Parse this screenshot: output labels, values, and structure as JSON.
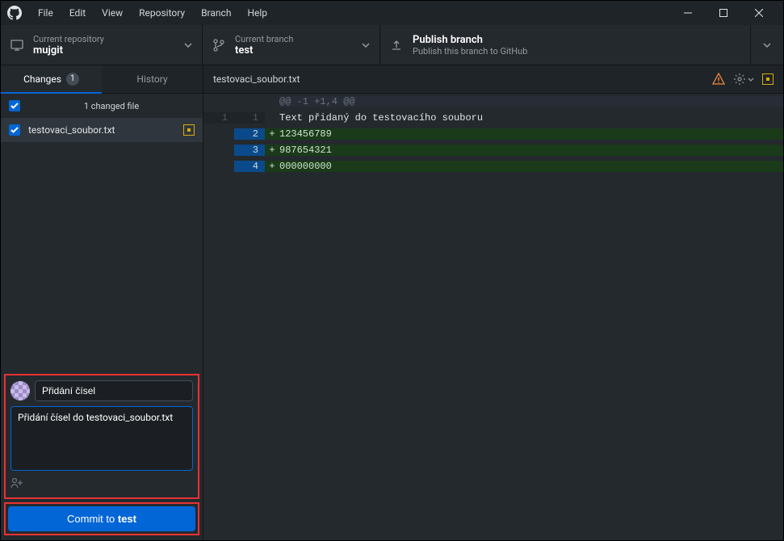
{
  "menu": [
    "File",
    "Edit",
    "View",
    "Repository",
    "Branch",
    "Help"
  ],
  "toolbar": {
    "repo_label": "Current repository",
    "repo_value": "mujgit",
    "branch_label": "Current branch",
    "branch_value": "test",
    "push_title": "Publish branch",
    "push_sub": "Publish this branch to GitHub"
  },
  "tabs": {
    "changes": "Changes",
    "changes_count": "1",
    "history": "History"
  },
  "files": {
    "header": "1 changed file",
    "items": [
      {
        "name": "testovaci_soubor.txt"
      }
    ]
  },
  "commit": {
    "summary": "Přidání čísel",
    "description": "Přidání čísel do testovaci_soubor.txt",
    "coauthor": "A+",
    "button_prefix": "Commit to ",
    "button_branch": "test"
  },
  "diff": {
    "filename": "testovaci_soubor.txt",
    "hunk": "@@ -1 +1,4 @@",
    "lines": [
      {
        "old": "1",
        "new": "1",
        "type": "context",
        "text": "Text přidaný do testovacího souboru"
      },
      {
        "old": "",
        "new": "2",
        "type": "added",
        "text": "123456789"
      },
      {
        "old": "",
        "new": "3",
        "type": "added",
        "text": "987654321"
      },
      {
        "old": "",
        "new": "4",
        "type": "added",
        "text": "000000000"
      }
    ]
  }
}
